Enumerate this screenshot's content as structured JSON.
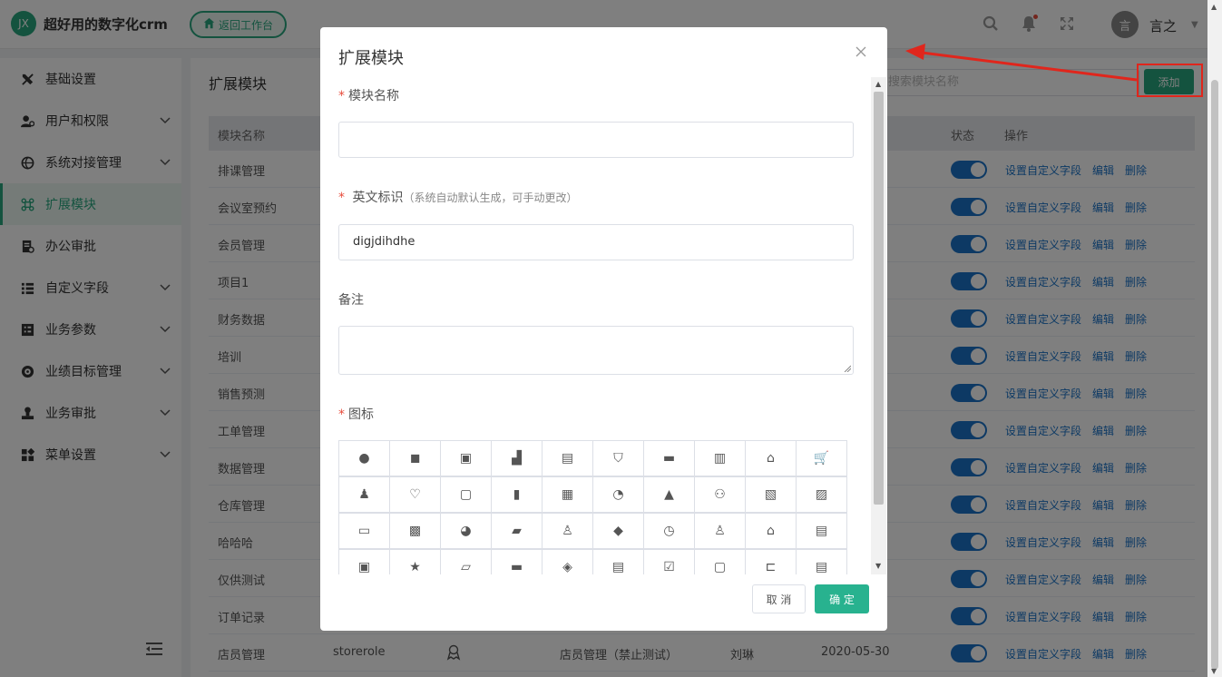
{
  "app": {
    "logo_text": "JX",
    "title": "超好用的数字化crm",
    "back_label": "返回工作台",
    "username": "言之",
    "avatar_text": "言"
  },
  "sidebar": {
    "items": [
      {
        "label": "基础设置",
        "icon": "tools-icon",
        "has_arrow": false,
        "active": false
      },
      {
        "label": "用户和权限",
        "icon": "user-key-icon",
        "has_arrow": true,
        "active": false
      },
      {
        "label": "系统对接管理",
        "icon": "globe-link-icon",
        "has_arrow": true,
        "active": false
      },
      {
        "label": "扩展模块",
        "icon": "extension-icon",
        "has_arrow": false,
        "active": true
      },
      {
        "label": "办公审批",
        "icon": "approval-icon",
        "has_arrow": false,
        "active": false
      },
      {
        "label": "自定义字段",
        "icon": "list-icon",
        "has_arrow": true,
        "active": false
      },
      {
        "label": "业务参数",
        "icon": "params-icon",
        "has_arrow": true,
        "active": false
      },
      {
        "label": "业绩目标管理",
        "icon": "target-icon",
        "has_arrow": true,
        "active": false
      },
      {
        "label": "业务审批",
        "icon": "stamp-icon",
        "has_arrow": true,
        "active": false
      },
      {
        "label": "菜单设置",
        "icon": "menu-grid-icon",
        "has_arrow": true,
        "active": false
      }
    ]
  },
  "main": {
    "title": "扩展模块",
    "search_placeholder": "搜索模块名称",
    "add_label": "添加",
    "table": {
      "headers": [
        "模块名称",
        "状态",
        "操作"
      ],
      "actions": [
        "设置自定义字段",
        "编辑",
        "删除"
      ],
      "rows": [
        {
          "name": "排课管理"
        },
        {
          "name": "会议室预约"
        },
        {
          "name": "会员管理"
        },
        {
          "name": "项目1"
        },
        {
          "name": "财务数据"
        },
        {
          "name": "培训"
        },
        {
          "name": "销售预测"
        },
        {
          "name": "工单管理"
        },
        {
          "name": "数据管理"
        },
        {
          "name": "仓库管理"
        },
        {
          "name": "哈哈哈"
        },
        {
          "name": "仅供测试"
        },
        {
          "name": "订单记录"
        },
        {
          "name": "店员管理",
          "code": "storerole",
          "desc": "店员管理（禁止测试）",
          "creator": "刘琳",
          "date": "2020-05-30"
        }
      ]
    }
  },
  "modal": {
    "title": "扩展模块",
    "name_label": "模块名称",
    "name_value": "",
    "code_label": "英文标识",
    "code_hint": "（系统自动默认生成，可手动更改）",
    "code_value": "digjdihdhe",
    "remark_label": "备注",
    "icon_label": "图标",
    "cancel_label": "取 消",
    "ok_label": "确 定",
    "icons": [
      {
        "name": "shield-round-icon",
        "glyph": "●"
      },
      {
        "name": "wallet-icon",
        "glyph": "◼"
      },
      {
        "name": "contact-card-icon",
        "glyph": "▣"
      },
      {
        "name": "bar-chart-icon",
        "glyph": "▟"
      },
      {
        "name": "document-icon",
        "glyph": "▤"
      },
      {
        "name": "badge-star-icon",
        "glyph": "⛉"
      },
      {
        "name": "printer-icon",
        "glyph": "▬"
      },
      {
        "name": "inbox-icon",
        "glyph": "▥"
      },
      {
        "name": "home-store-icon",
        "glyph": "⌂"
      },
      {
        "name": "cart-icon",
        "glyph": "🛒"
      },
      {
        "name": "stamp-icon",
        "glyph": "♟"
      },
      {
        "name": "heart-handshake-icon",
        "glyph": "♡"
      },
      {
        "name": "clipboard-icon",
        "glyph": "▢"
      },
      {
        "name": "column-chart-icon",
        "glyph": "▮"
      },
      {
        "name": "notepad-icon",
        "glyph": "▦"
      },
      {
        "name": "refresh-clock-icon",
        "glyph": "◔"
      },
      {
        "name": "graduation-icon",
        "glyph": "▲"
      },
      {
        "name": "medal-icon",
        "glyph": "⚇"
      },
      {
        "name": "storefront-icon",
        "glyph": "▧"
      },
      {
        "name": "id-card-icon",
        "glyph": "▨"
      },
      {
        "name": "card-wallet-icon",
        "glyph": "▭"
      },
      {
        "name": "film-icon",
        "glyph": "▩"
      },
      {
        "name": "pie-chart-icon",
        "glyph": "◕"
      },
      {
        "name": "car-icon",
        "glyph": "▰"
      },
      {
        "name": "user-badge-icon",
        "glyph": "♙"
      },
      {
        "name": "tag-icon",
        "glyph": "◆"
      },
      {
        "name": "history-icon",
        "glyph": "◷"
      },
      {
        "name": "add-user-icon",
        "glyph": "♙"
      },
      {
        "name": "bank-icon",
        "glyph": "⌂"
      },
      {
        "name": "clipboard-check-icon",
        "glyph": "▤"
      },
      {
        "name": "save-icon",
        "glyph": "▣"
      },
      {
        "name": "star-icon",
        "glyph": "★"
      },
      {
        "name": "clapper-icon",
        "glyph": "▱"
      },
      {
        "name": "receipt-icon",
        "glyph": "▬"
      },
      {
        "name": "layers-icon",
        "glyph": "◈"
      },
      {
        "name": "edit-doc-icon",
        "glyph": "▤"
      },
      {
        "name": "checkbox-icon",
        "glyph": "☑"
      },
      {
        "name": "lock-icon",
        "glyph": "▢"
      },
      {
        "name": "link-icon",
        "glyph": "⊏"
      },
      {
        "name": "invoice-icon",
        "glyph": "▤"
      }
    ]
  },
  "colors": {
    "brand": "#28a77e",
    "link": "#1a73c8",
    "highlight": "#e0261c"
  }
}
